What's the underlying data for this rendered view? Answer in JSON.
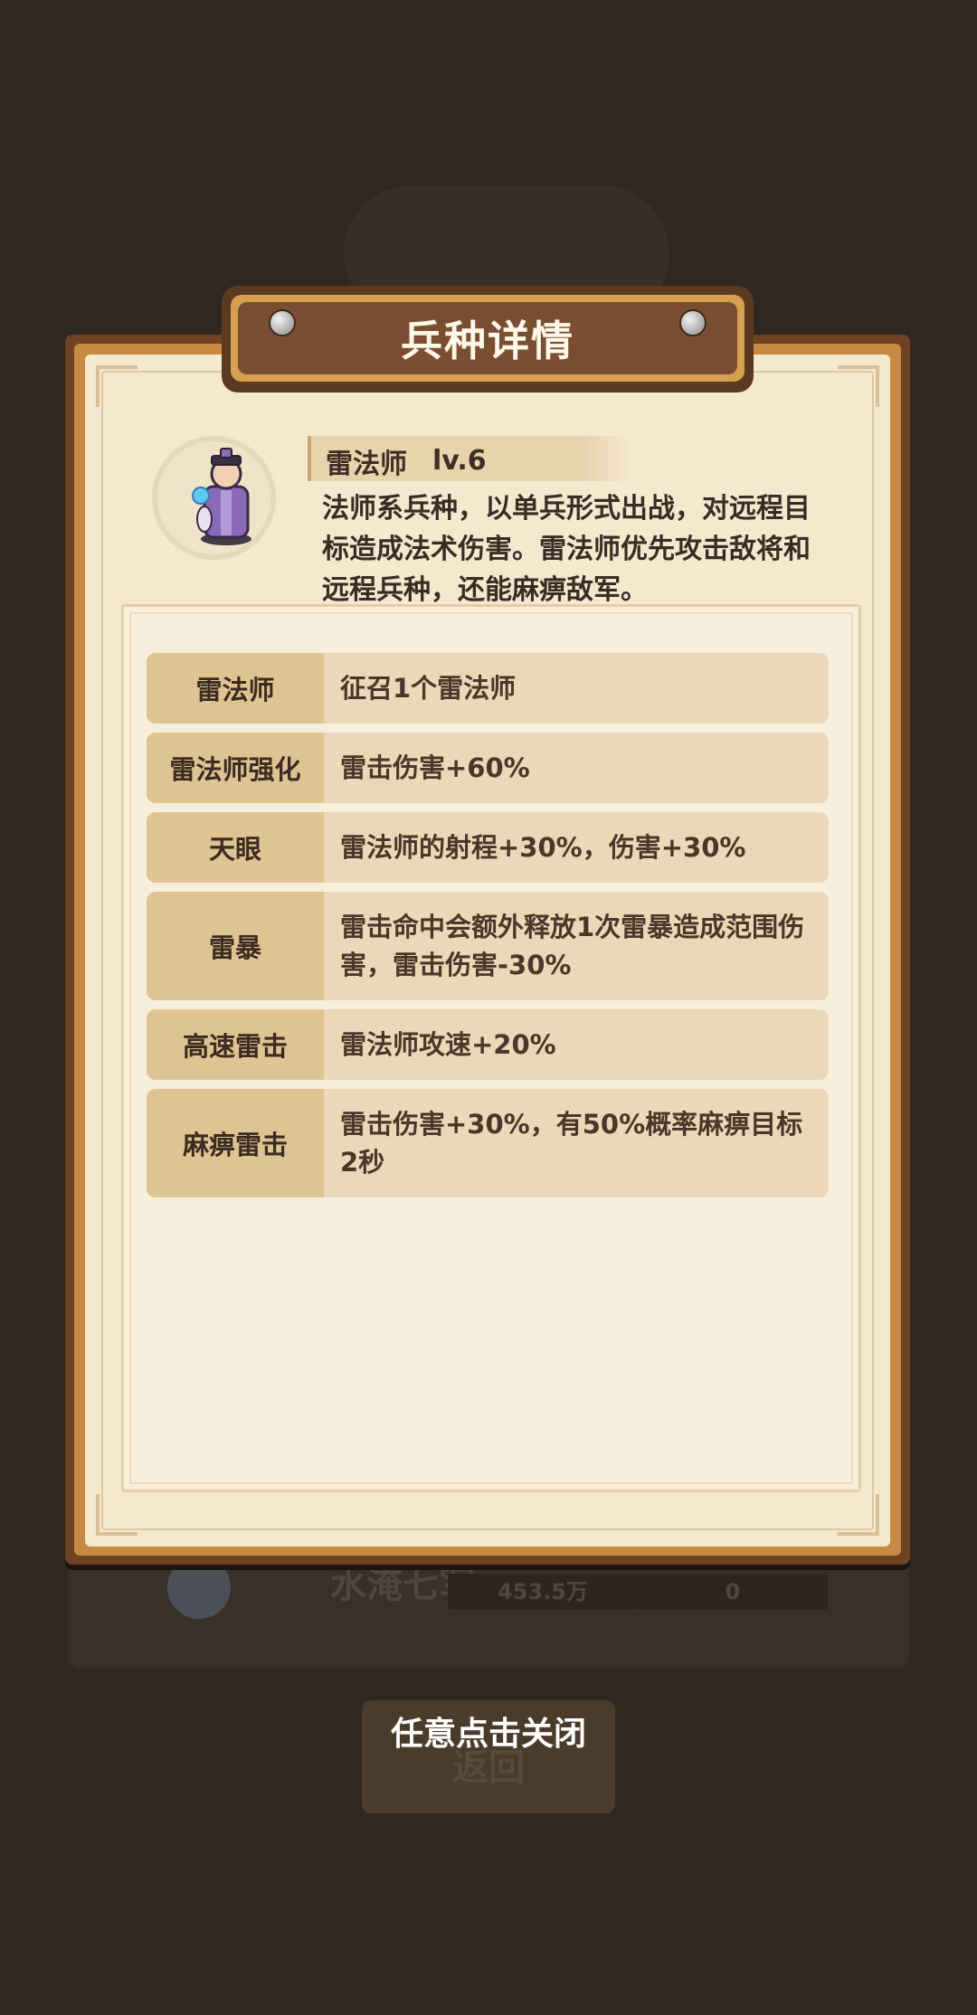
{
  "background": {
    "row_name": "水淹七军",
    "row_value_1": "453.5万",
    "row_value_2": "0",
    "return_label": "返回"
  },
  "dialog": {
    "title": "兵种详情",
    "unit": {
      "name": "雷法师",
      "level": "lv.6",
      "description": "法师系兵种，以单兵形式出战，对远程目标造成法术伤害。雷法师优先攻击敌将和远程兵种，还能麻痹敌军。"
    },
    "upgrades": [
      {
        "label": "雷法师",
        "text": "征召1个雷法师"
      },
      {
        "label": "雷法师强化",
        "text": "雷击伤害+60%"
      },
      {
        "label": "天眼",
        "text": "雷法师的射程+30%，伤害+30%"
      },
      {
        "label": "雷暴",
        "text": "雷击命中会额外释放1次雷暴造成范围伤害，雷击伤害-30%"
      },
      {
        "label": "高速雷击",
        "text": "雷法师攻速+20%"
      },
      {
        "label": "麻痹雷击",
        "text": "雷击伤害+30%，有50%概率麻痹目标2秒"
      }
    ]
  },
  "close_hint": "任意点击关闭",
  "colors": {
    "backdrop": "#2f2823",
    "paper": "#f4e8cf",
    "label_bg": "#dfc493",
    "text_bg": "#ead8b8",
    "banner": "#7a4e30"
  }
}
